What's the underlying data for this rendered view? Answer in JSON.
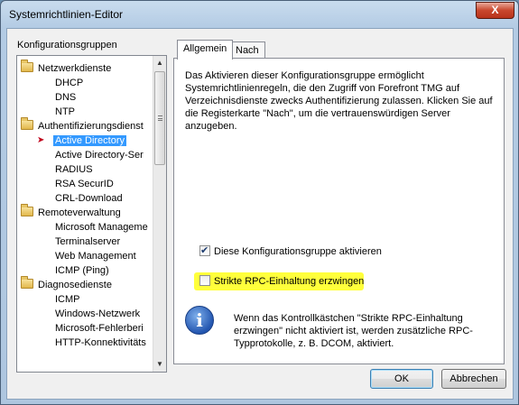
{
  "window": {
    "title": "Systemrichtlinien-Editor",
    "close_glyph": "X"
  },
  "tree": {
    "label": "Konfigurationsgruppen",
    "items": [
      {
        "label": "Netzwerkdienste"
      },
      {
        "label": "DHCP"
      },
      {
        "label": "DNS"
      },
      {
        "label": "NTP"
      },
      {
        "label": "Authentifizierungsdienst"
      },
      {
        "label": "Active Directory"
      },
      {
        "label": "Active Directory-Ser"
      },
      {
        "label": "RADIUS"
      },
      {
        "label": "RSA SecurID"
      },
      {
        "label": "CRL-Download"
      },
      {
        "label": "Remoteverwaltung"
      },
      {
        "label": "Microsoft Manageme"
      },
      {
        "label": "Terminalserver"
      },
      {
        "label": "Web Management"
      },
      {
        "label": "ICMP (Ping)"
      },
      {
        "label": "Diagnosedienste"
      },
      {
        "label": "ICMP"
      },
      {
        "label": "Windows-Netzwerk"
      },
      {
        "label": "Microsoft-Fehlerberi"
      },
      {
        "label": "HTTP-Konnektivitäts"
      }
    ],
    "selected_icon": "red-arrow-icon",
    "scroll": {
      "up_glyph": "▲",
      "down_glyph": "▼"
    }
  },
  "tabs": [
    {
      "label": "Allgemein"
    },
    {
      "label": "Nach"
    }
  ],
  "panel": {
    "description": "Das Aktivieren dieser Konfigurationsgruppe ermöglicht Systemrichtlinienregeln, die den Zugriff von Forefront TMG auf Verzeichnisdienste zwecks Authentifizierung zulassen. Klicken Sie auf die Registerkarte \"Nach\", um die vertrauenswürdigen Server anzugeben.",
    "activate_checkbox": {
      "label": "Diese Konfigurationsgruppe aktivieren",
      "checked": true
    },
    "rpc_checkbox": {
      "label": "Strikte RPC-Einhaltung erzwingen",
      "checked": false
    },
    "info_glyph": "i",
    "info_text": "Wenn das Kontrollkästchen \"Strikte RPC-Einhaltung erzwingen\" nicht aktiviert ist, werden zusätzliche RPC-Typprotokolle, z. B. DCOM, aktiviert.",
    "highlight_color": "#ffff3b"
  },
  "buttons": {
    "ok": "OK",
    "cancel": "Abbrechen"
  }
}
